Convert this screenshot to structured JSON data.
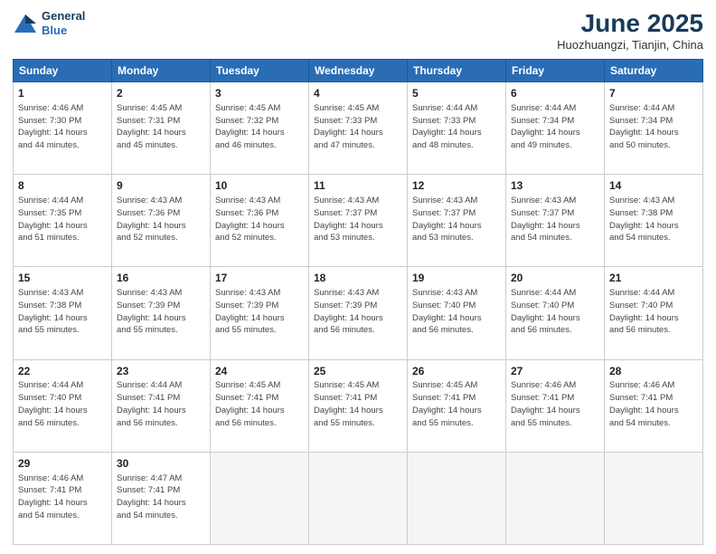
{
  "header": {
    "logo_line1": "General",
    "logo_line2": "Blue",
    "title": "June 2025",
    "subtitle": "Huozhuangzi, Tianjin, China"
  },
  "columns": [
    "Sunday",
    "Monday",
    "Tuesday",
    "Wednesday",
    "Thursday",
    "Friday",
    "Saturday"
  ],
  "weeks": [
    [
      {
        "day": "1",
        "info": "Sunrise: 4:46 AM\nSunset: 7:30 PM\nDaylight: 14 hours\nand 44 minutes."
      },
      {
        "day": "2",
        "info": "Sunrise: 4:45 AM\nSunset: 7:31 PM\nDaylight: 14 hours\nand 45 minutes."
      },
      {
        "day": "3",
        "info": "Sunrise: 4:45 AM\nSunset: 7:32 PM\nDaylight: 14 hours\nand 46 minutes."
      },
      {
        "day": "4",
        "info": "Sunrise: 4:45 AM\nSunset: 7:33 PM\nDaylight: 14 hours\nand 47 minutes."
      },
      {
        "day": "5",
        "info": "Sunrise: 4:44 AM\nSunset: 7:33 PM\nDaylight: 14 hours\nand 48 minutes."
      },
      {
        "day": "6",
        "info": "Sunrise: 4:44 AM\nSunset: 7:34 PM\nDaylight: 14 hours\nand 49 minutes."
      },
      {
        "day": "7",
        "info": "Sunrise: 4:44 AM\nSunset: 7:34 PM\nDaylight: 14 hours\nand 50 minutes."
      }
    ],
    [
      {
        "day": "8",
        "info": "Sunrise: 4:44 AM\nSunset: 7:35 PM\nDaylight: 14 hours\nand 51 minutes."
      },
      {
        "day": "9",
        "info": "Sunrise: 4:43 AM\nSunset: 7:36 PM\nDaylight: 14 hours\nand 52 minutes."
      },
      {
        "day": "10",
        "info": "Sunrise: 4:43 AM\nSunset: 7:36 PM\nDaylight: 14 hours\nand 52 minutes."
      },
      {
        "day": "11",
        "info": "Sunrise: 4:43 AM\nSunset: 7:37 PM\nDaylight: 14 hours\nand 53 minutes."
      },
      {
        "day": "12",
        "info": "Sunrise: 4:43 AM\nSunset: 7:37 PM\nDaylight: 14 hours\nand 53 minutes."
      },
      {
        "day": "13",
        "info": "Sunrise: 4:43 AM\nSunset: 7:37 PM\nDaylight: 14 hours\nand 54 minutes."
      },
      {
        "day": "14",
        "info": "Sunrise: 4:43 AM\nSunset: 7:38 PM\nDaylight: 14 hours\nand 54 minutes."
      }
    ],
    [
      {
        "day": "15",
        "info": "Sunrise: 4:43 AM\nSunset: 7:38 PM\nDaylight: 14 hours\nand 55 minutes."
      },
      {
        "day": "16",
        "info": "Sunrise: 4:43 AM\nSunset: 7:39 PM\nDaylight: 14 hours\nand 55 minutes."
      },
      {
        "day": "17",
        "info": "Sunrise: 4:43 AM\nSunset: 7:39 PM\nDaylight: 14 hours\nand 55 minutes."
      },
      {
        "day": "18",
        "info": "Sunrise: 4:43 AM\nSunset: 7:39 PM\nDaylight: 14 hours\nand 56 minutes."
      },
      {
        "day": "19",
        "info": "Sunrise: 4:43 AM\nSunset: 7:40 PM\nDaylight: 14 hours\nand 56 minutes."
      },
      {
        "day": "20",
        "info": "Sunrise: 4:44 AM\nSunset: 7:40 PM\nDaylight: 14 hours\nand 56 minutes."
      },
      {
        "day": "21",
        "info": "Sunrise: 4:44 AM\nSunset: 7:40 PM\nDaylight: 14 hours\nand 56 minutes."
      }
    ],
    [
      {
        "day": "22",
        "info": "Sunrise: 4:44 AM\nSunset: 7:40 PM\nDaylight: 14 hours\nand 56 minutes."
      },
      {
        "day": "23",
        "info": "Sunrise: 4:44 AM\nSunset: 7:41 PM\nDaylight: 14 hours\nand 56 minutes."
      },
      {
        "day": "24",
        "info": "Sunrise: 4:45 AM\nSunset: 7:41 PM\nDaylight: 14 hours\nand 56 minutes."
      },
      {
        "day": "25",
        "info": "Sunrise: 4:45 AM\nSunset: 7:41 PM\nDaylight: 14 hours\nand 55 minutes."
      },
      {
        "day": "26",
        "info": "Sunrise: 4:45 AM\nSunset: 7:41 PM\nDaylight: 14 hours\nand 55 minutes."
      },
      {
        "day": "27",
        "info": "Sunrise: 4:46 AM\nSunset: 7:41 PM\nDaylight: 14 hours\nand 55 minutes."
      },
      {
        "day": "28",
        "info": "Sunrise: 4:46 AM\nSunset: 7:41 PM\nDaylight: 14 hours\nand 54 minutes."
      }
    ],
    [
      {
        "day": "29",
        "info": "Sunrise: 4:46 AM\nSunset: 7:41 PM\nDaylight: 14 hours\nand 54 minutes."
      },
      {
        "day": "30",
        "info": "Sunrise: 4:47 AM\nSunset: 7:41 PM\nDaylight: 14 hours\nand 54 minutes."
      },
      {
        "day": "",
        "info": ""
      },
      {
        "day": "",
        "info": ""
      },
      {
        "day": "",
        "info": ""
      },
      {
        "day": "",
        "info": ""
      },
      {
        "day": "",
        "info": ""
      }
    ]
  ]
}
